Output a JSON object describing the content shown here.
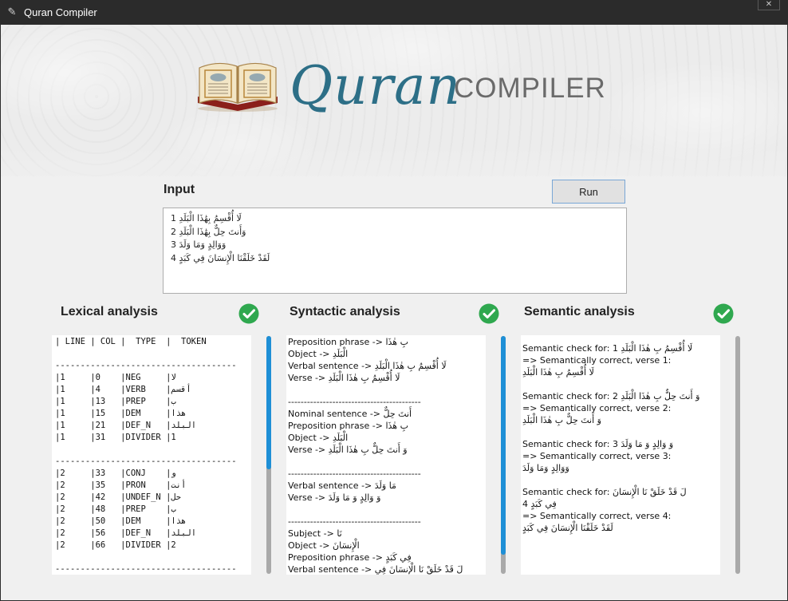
{
  "window": {
    "title": "Quran Compiler",
    "icon": "feather-icon",
    "close": "✕"
  },
  "logo": {
    "word1": "Quran",
    "word2": "COMPILER",
    "image": "quran-book-icon"
  },
  "input": {
    "label": "Input",
    "run_label": "Run",
    "lines": [
      "لَا أُقْسِمُ بِهَٰذَا الْبَلَدِ 1",
      "وَأَنتَ حِلٌّ بِهَٰذَا الْبَلَدِ 2",
      "وَوَالِدٍ وَمَا وَلَدَ 3",
      "لَقَدْ خَلَقْنَا الْإِنسَانَ فِي كَبَدٍ 4"
    ]
  },
  "lexical": {
    "title": "Lexical analysis",
    "status_icon": "check-circle-icon",
    "lines": [
      "| LINE | COL |  TYPE  |  TOKEN",
      "",
      "------------------------------------",
      "|1     |0    |NEG     |لا",
      "|1     |4    |VERB    |أقسم",
      "|1     |13   |PREP    |ب",
      "|1     |15   |DEM     |هذا",
      "|1     |21   |DEF_N   |البلد",
      "|1     |31   |DIVIDER |1",
      "",
      "------------------------------------",
      "|2     |33   |CONJ    |و",
      "|2     |35   |PRON    |أنت",
      "|2     |42   |UNDEF_N |حل",
      "|2     |48   |PREP    |ب",
      "|2     |50   |DEM     |هذا",
      "|2     |56   |DEF_N   |البلد",
      "|2     |66   |DIVIDER |2",
      "",
      "------------------------------------"
    ]
  },
  "syntactic": {
    "title": "Syntactic analysis",
    "status_icon": "check-circle-icon",
    "lines": [
      "Preposition phrase -> بِ هٰذَا",
      "Object -> الْبَلَدِ",
      "Verbal sentence -> لَا أُقْسِمُ بِ هٰذَا الْبَلَدِ",
      "Verse -> لَا أُقْسِمُ بِ هٰذَا الْبَلَدِ",
      "",
      "------------------------------------------",
      "Nominal sentence -> أَنتَ حِلٌّ",
      "Preposition phrase -> بِ هٰذَا",
      "Object -> الْبَلَدِ",
      "Verse -> وَ أَنتَ حِلٌّ بِ هٰذَا الْبَلَدِ",
      "",
      "------------------------------------------",
      "Verbal sentence -> مَا وَلَدَ",
      "Verse -> وَ وَالِدٍ وَ مَا وَلَدَ",
      "",
      "------------------------------------------",
      "Subject -> نَا",
      "Object -> الْإِنسَانَ",
      "Preposition phrase -> فِي كَبَدٍ",
      "Verbal sentence -> لَ قَدْ خَلَقْ نَا الْإِنسَانَ فِي"
    ],
    "scroll_fraction": 0.56
  },
  "semantic": {
    "title": "Semantic analysis",
    "status_icon": "check-circle-icon",
    "lines": [
      "Semantic check for: لَا أُقْسِمُ بِ هٰذَا الْبَلَدِ 1",
      "=> Semantically correct, verse 1:",
      "لَا أُقْسِمُ بِ هٰذَا الْبَلَدِ",
      "",
      "Semantic check for: وَ أَنتَ حِلٌّ بِ هٰذَا الْبَلَدِ 2",
      "=> Semantically correct, verse 2:",
      "وَ أَنتَ حِلٌّ بِ هٰذَا الْبَلَدِ",
      "",
      "Semantic check for: وَ وَالِدٍ وَ مَا وَلَدَ 3",
      "=> Semantically correct, verse 3:",
      "وَوَالِدٍ وَمَا وَلَدَ",
      "",
      "Semantic check for: لَ قَدْ خَلَقْ نَا الْإِنسَانَ",
      "فِي كَبَدٍ 4",
      "=> Semantically correct, verse 4:",
      "لَقَدْ خَلَقْنَا الْإِنسَانَ فِي كَبَدٍ"
    ],
    "scroll_fraction": 0.92
  },
  "colors": {
    "accent": "#1e8fd6",
    "check": "#2fa84f",
    "logo_blue": "#2d6f87",
    "logo_gray": "#6a6a6a"
  }
}
